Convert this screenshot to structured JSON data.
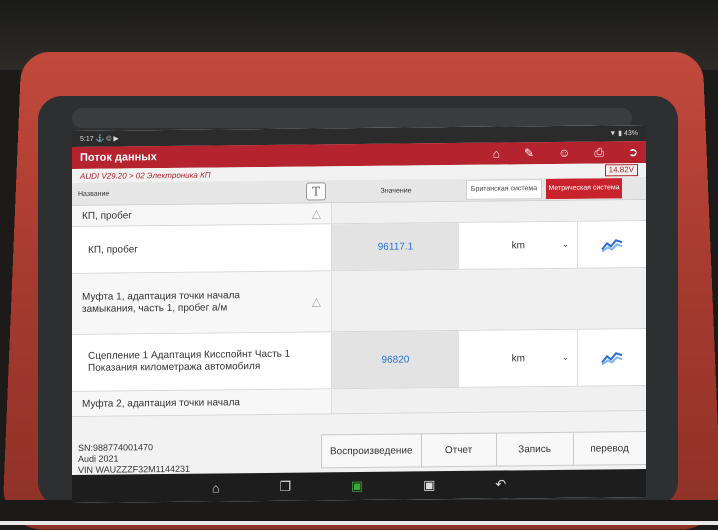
{
  "statusbar": {
    "time": "5:17",
    "left_icons": "⚓ © ▶",
    "right": "▼ ▮ 43%"
  },
  "header": {
    "title": "Поток данных",
    "icons": [
      "home-icon",
      "edit-icon",
      "user-icon",
      "print-icon",
      "exit-icon"
    ]
  },
  "breadcrumb": "AUDI V29.20 > 02 Электроника КП",
  "battery": "14.82V",
  "columns": {
    "name": "Название",
    "value": "Значение",
    "unit_british": "Британская система",
    "unit_metric": "Метрическая система",
    "t_button": "T"
  },
  "rows": [
    {
      "kind": "group",
      "name": "КП, пробег"
    },
    {
      "kind": "item",
      "name": "КП, пробег",
      "value": "96117.1",
      "unit": "km"
    },
    {
      "kind": "group",
      "name": "Муфта 1, адаптация точки начала замыкания, часть 1, пробег а/м"
    },
    {
      "kind": "item",
      "name": "Сцепление 1 Адаптация Кисспойнт Часть 1 Показания километража автомобиля",
      "value": "96820",
      "unit": "km"
    },
    {
      "kind": "group",
      "name": "Муфта 2, адаптация точки начала"
    }
  ],
  "vehicle": {
    "sn": "SN:988774001470",
    "model": "Audi  2021",
    "vin": "VIN WAUZZZF32M1144231"
  },
  "buttons": {
    "playback": "Воспроизведение",
    "report": "Отчет",
    "record": "Запись",
    "translate": "перевод"
  },
  "nav": [
    "home-icon",
    "recent-apps-icon",
    "vci-icon",
    "screenshot-icon",
    "back-icon"
  ],
  "colors": {
    "brand_red": "#b5242e",
    "value_blue": "#2a6fd6"
  }
}
